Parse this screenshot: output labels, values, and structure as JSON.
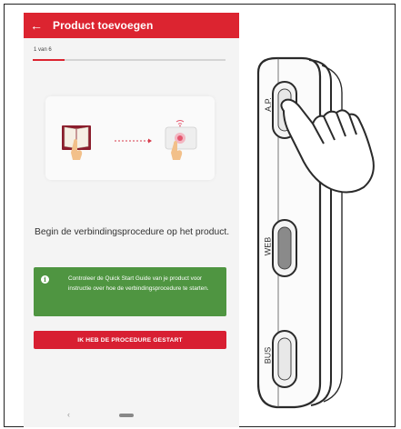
{
  "app": {
    "title": "Product toevoegen",
    "back_icon": "←",
    "accent_color": "#dc2430"
  },
  "progress": {
    "step_label": "1 van 6",
    "fraction": 0.1667
  },
  "instruction": "Begin de verbindingsprocedure op het product.",
  "info": {
    "icon": "i",
    "text": "Controleer de Quick Start Guide van je product voor instructie over hoe de verbindingsprocedure te starten.",
    "color": "#4f9541"
  },
  "primary_button": "IK HEB DE PROCEDURE GESTART",
  "navigation": {
    "back_glyph": "‹"
  },
  "device": {
    "buttons": [
      "A.P.",
      "WEB",
      "BUS"
    ]
  }
}
